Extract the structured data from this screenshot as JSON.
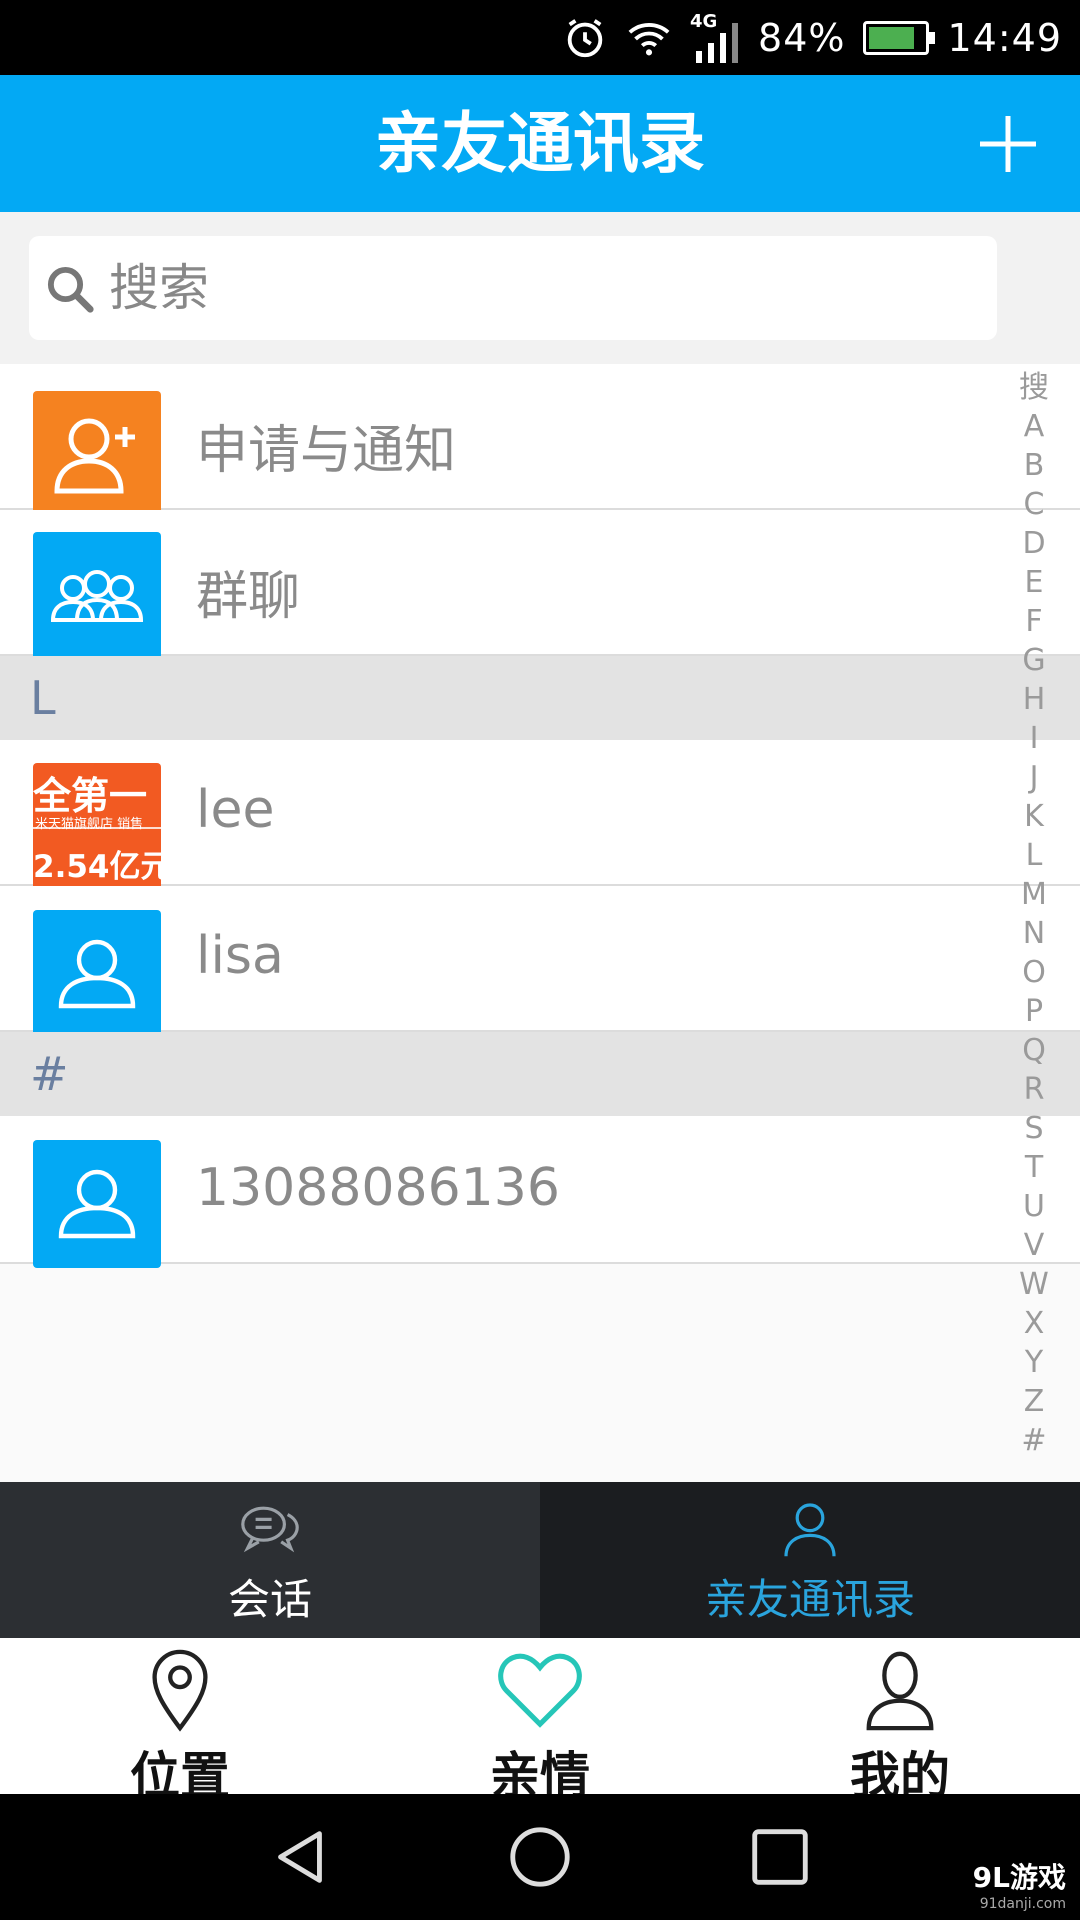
{
  "status_bar": {
    "network": "4G",
    "battery": "84%",
    "battery_level": 0.84,
    "time": "14:49"
  },
  "header": {
    "title": "亲友通讯录"
  },
  "search": {
    "placeholder": "搜索"
  },
  "list": {
    "fixed_items": [
      {
        "label": "申请与通知",
        "icon": "add-user-icon",
        "color": "#f58220"
      },
      {
        "label": "群聊",
        "icon": "group-icon",
        "color": "#03a9f4"
      }
    ],
    "sections": [
      {
        "header": "L",
        "contacts": [
          {
            "name": "lee",
            "avatar": "photo"
          },
          {
            "name": "lisa",
            "avatar": "default-user-icon"
          }
        ]
      },
      {
        "header": "#",
        "contacts": [
          {
            "name": "13088086136",
            "avatar": "default-user-icon"
          }
        ]
      }
    ]
  },
  "avatar_photo": {
    "line1": "全第一",
    "line2": "米天猫旗舰店 销售",
    "line3": "2.54亿元"
  },
  "az_index": [
    "搜",
    "A",
    "B",
    "C",
    "D",
    "E",
    "F",
    "G",
    "H",
    "I",
    "J",
    "K",
    "L",
    "M",
    "N",
    "O",
    "P",
    "Q",
    "R",
    "S",
    "T",
    "U",
    "V",
    "W",
    "X",
    "Y",
    "Z",
    "#"
  ],
  "inner_tabs": [
    {
      "label": "会话",
      "icon": "chat-icon",
      "active": false
    },
    {
      "label": "亲友通讯录",
      "icon": "contact-icon",
      "active": true
    }
  ],
  "bottom_nav": [
    {
      "label": "位置",
      "icon": "location-pin-icon"
    },
    {
      "label": "亲情",
      "icon": "heart-icon"
    },
    {
      "label": "我的",
      "icon": "profile-icon"
    }
  ],
  "watermark": {
    "main": "9L游戏",
    "sub": "91danji.com"
  },
  "colors": {
    "accent": "#03a9f4",
    "orange": "#f58220",
    "active_tab": "#2aa4dd",
    "heart": "#26c6b8"
  }
}
